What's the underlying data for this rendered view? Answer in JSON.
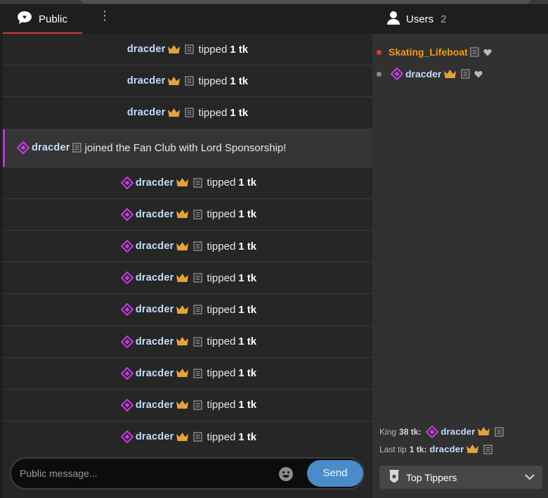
{
  "chat": {
    "tab_public": "Public",
    "messages": [
      {
        "type": "tip",
        "user": "dracder",
        "diamond": false,
        "verb": "tipped",
        "amount": "1 tk"
      },
      {
        "type": "tip",
        "user": "dracder",
        "diamond": false,
        "verb": "tipped",
        "amount": "1 tk"
      },
      {
        "type": "tip",
        "user": "dracder",
        "diamond": false,
        "verb": "tipped",
        "amount": "1 tk"
      },
      {
        "type": "fan",
        "user": "dracder",
        "diamond": true,
        "text": "joined the Fan Club with Lord Sponsorship!"
      },
      {
        "type": "tip",
        "user": "dracder",
        "diamond": true,
        "verb": "tipped",
        "amount": "1 tk"
      },
      {
        "type": "tip",
        "user": "dracder",
        "diamond": true,
        "verb": "tipped",
        "amount": "1 tk"
      },
      {
        "type": "tip",
        "user": "dracder",
        "diamond": true,
        "verb": "tipped",
        "amount": "1 tk"
      },
      {
        "type": "tip",
        "user": "dracder",
        "diamond": true,
        "verb": "tipped",
        "amount": "1 tk"
      },
      {
        "type": "tip",
        "user": "dracder",
        "diamond": true,
        "verb": "tipped",
        "amount": "1 tk"
      },
      {
        "type": "tip",
        "user": "dracder",
        "diamond": true,
        "verb": "tipped",
        "amount": "1 tk"
      },
      {
        "type": "tip",
        "user": "dracder",
        "diamond": true,
        "verb": "tipped",
        "amount": "1 tk"
      },
      {
        "type": "tip",
        "user": "dracder",
        "diamond": true,
        "verb": "tipped",
        "amount": "1 tk"
      },
      {
        "type": "tip",
        "user": "dracder",
        "diamond": true,
        "verb": "tipped",
        "amount": "1 tk"
      }
    ],
    "composer": {
      "placeholder": "Public message...",
      "send_label": "Send"
    }
  },
  "users_panel": {
    "title": "Users",
    "count": "2",
    "list": [
      {
        "name": "Skating_Lifeboat",
        "status_color": "#e03a3a",
        "name_color": "#f39a1d",
        "diamond": false,
        "crown": false
      },
      {
        "name": "dracder",
        "status_color": "#8a8a8a",
        "name_color": "#c4ddff",
        "diamond": true,
        "crown": true
      }
    ],
    "king": {
      "label": "King",
      "amount": "38 tk:",
      "user": "dracder"
    },
    "last_tip": {
      "label": "Last tip",
      "amount": "1 tk:",
      "user": "dracder"
    },
    "top_tippers_label": "Top Tippers"
  },
  "colors": {
    "accent_red": "#d63b3b",
    "diamond_purple": "#c93ae8",
    "crown_gold": "#e2a33e",
    "send_blue": "#4a8bc9",
    "username_blue": "#c4ddff"
  }
}
